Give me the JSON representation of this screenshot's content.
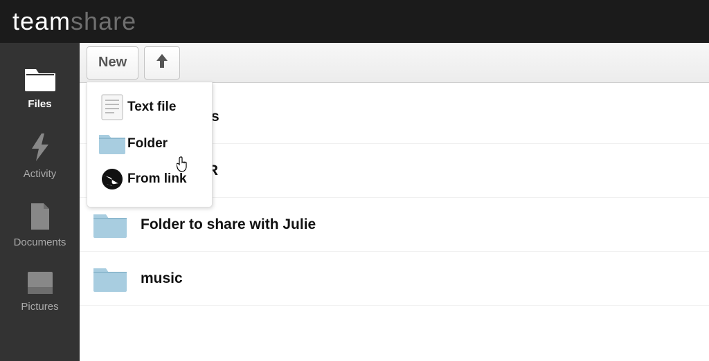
{
  "logo": {
    "part1": "team",
    "part2": "share"
  },
  "sidebar": {
    "items": [
      {
        "label": "Files",
        "active": true
      },
      {
        "label": "Activity",
        "active": false
      },
      {
        "label": "Documents",
        "active": false
      },
      {
        "label": "Pictures",
        "active": false
      }
    ]
  },
  "toolbar": {
    "new_label": "New"
  },
  "new_menu": {
    "items": [
      {
        "label": "Text file"
      },
      {
        "label": "Folder"
      },
      {
        "label": "From link"
      }
    ]
  },
  "files": [
    {
      "name": "Emerge PR"
    },
    {
      "name": "Folder to share with Julie"
    },
    {
      "name": "music"
    }
  ],
  "hidden_file_name_fragment": "s"
}
